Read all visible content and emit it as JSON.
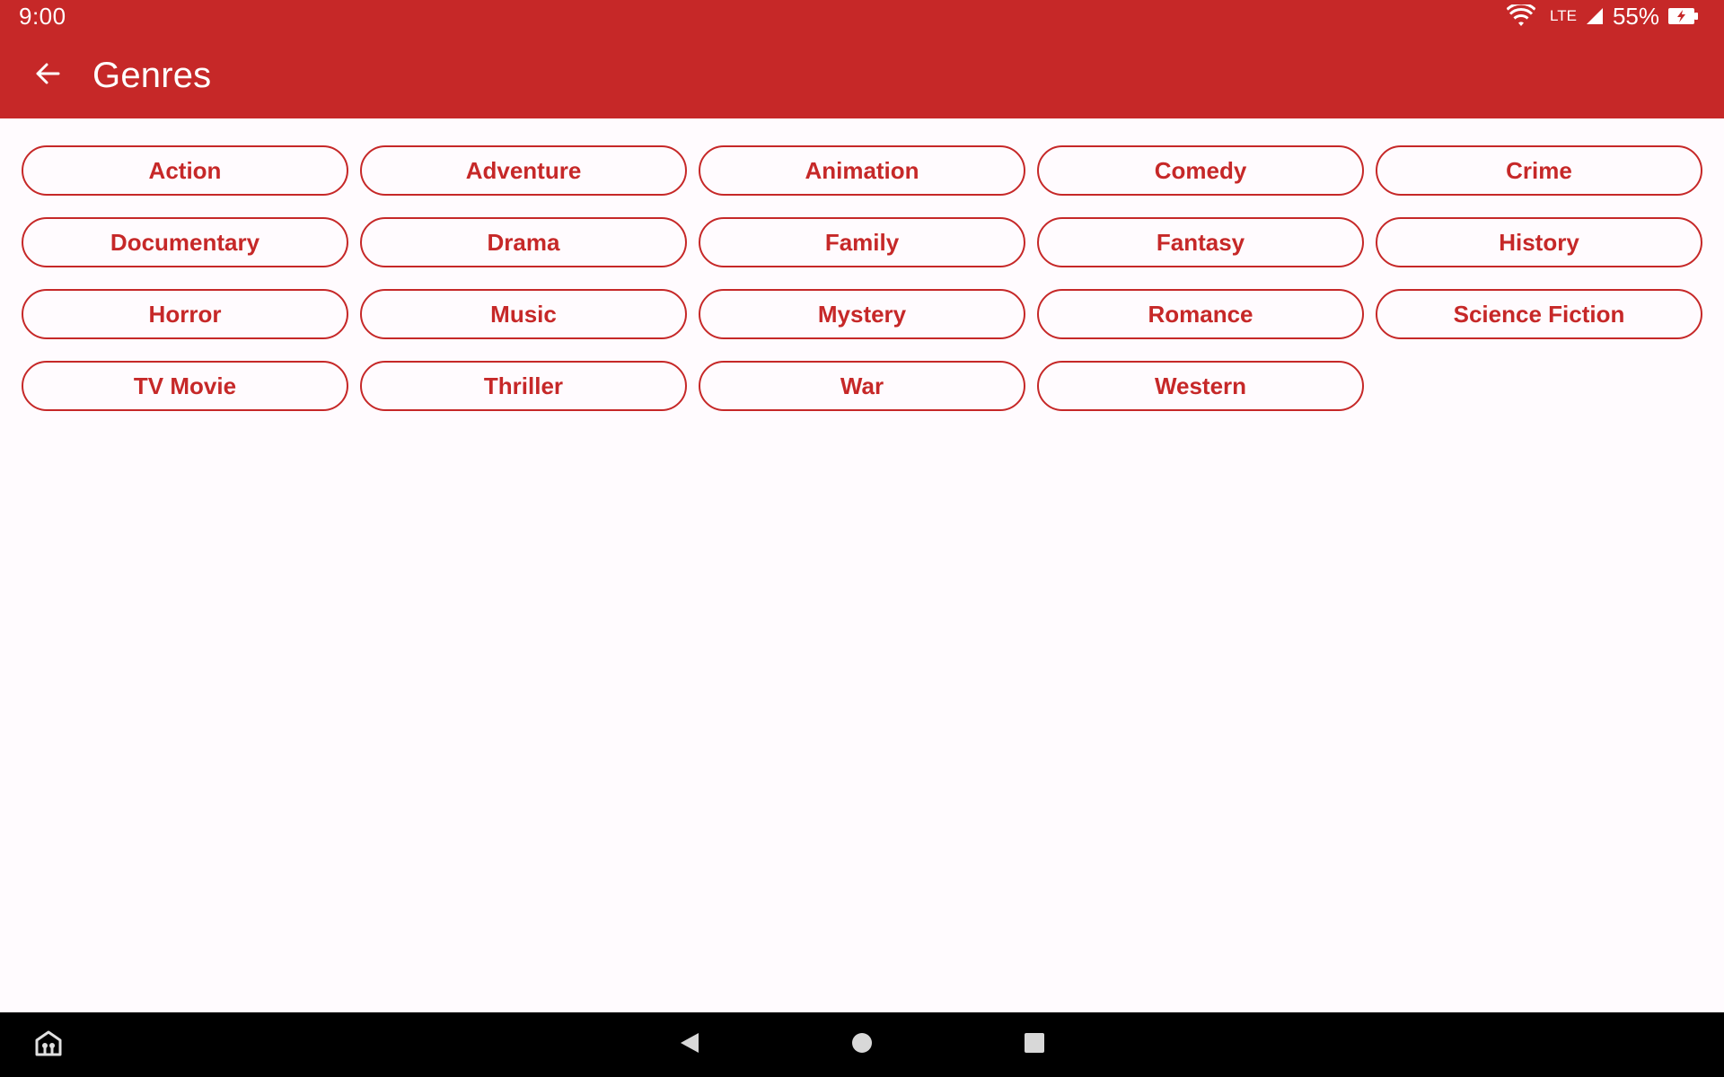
{
  "status_bar": {
    "time": "9:00",
    "network": "LTE",
    "battery": "55%"
  },
  "app_bar": {
    "title": "Genres",
    "back_icon": "arrow-left-icon"
  },
  "genres": [
    "Action",
    "Adventure",
    "Animation",
    "Comedy",
    "Crime",
    "Documentary",
    "Drama",
    "Family",
    "Fantasy",
    "History",
    "Horror",
    "Music",
    "Mystery",
    "Romance",
    "Science Fiction",
    "TV Movie",
    "Thriller",
    "War",
    "Western"
  ],
  "nav_bar": {
    "icons": [
      "assistant-icon",
      "back-triangle-icon",
      "home-circle-icon",
      "recents-square-icon"
    ]
  },
  "colors": {
    "primary": "#c62828",
    "background": "#fffbfe",
    "nav": "#000000"
  }
}
